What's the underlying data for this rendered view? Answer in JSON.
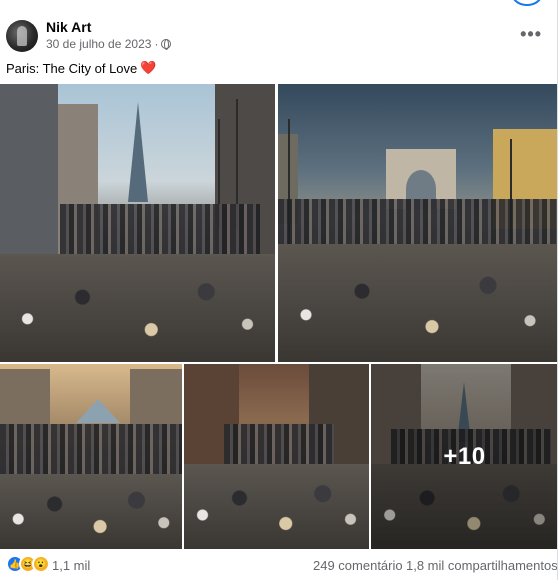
{
  "post": {
    "author": "Nik Art",
    "date": "30 de julho de 2023",
    "date_separator": "·",
    "privacy_icon": "globe-icon",
    "more_label": "•••",
    "caption": "Paris: The City of Love",
    "caption_emoji": "❤️"
  },
  "gallery": {
    "photos": [
      {
        "description": "Eiffel Tower street with garbage"
      },
      {
        "description": "Arc de Triomphe avenue with garbage"
      },
      {
        "description": "Louvre pyramid courtyard with garbage"
      },
      {
        "description": "Narrow street with garbage"
      },
      {
        "description": "Street with Eiffel Tower in distance"
      }
    ],
    "more_count": "+10"
  },
  "footer": {
    "reactions": [
      "like-icon",
      "haha-icon",
      "wow-icon"
    ],
    "reaction_count": "1,1 mil",
    "comments": "249 comentário",
    "shares": "1,8 mil compartilhamentos"
  },
  "colors": {
    "brand_blue": "#1877f2",
    "secondary_text": "#65676b",
    "heart_red": "#e41e3f"
  }
}
